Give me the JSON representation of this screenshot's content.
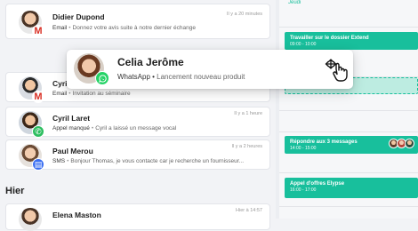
{
  "feed": {
    "items": [
      {
        "name": "Didier Dupond",
        "channel": "Email",
        "text": "Donnez votre avis suite à notre dernier échange",
        "time": "Il y a 20 minutes"
      },
      {
        "name": "Cyril Laret",
        "channel": "Email",
        "text": "Invitation au séminaire",
        "time": ""
      },
      {
        "name": "Cyril Laret",
        "channel": "Appel manqué",
        "text": "Cyril a laissé un message vocal",
        "time": "Il y a 1 heure"
      },
      {
        "name": "Paul Merou",
        "channel": "SMS",
        "text": "Bonjour Thomas, je vous contacte car je recherche un fournisseur...",
        "time": "Il y a 2 heures"
      },
      {
        "name": "Elena Maston",
        "channel": "",
        "text": "",
        "time": "Hier à 14:57"
      }
    ],
    "section_yesterday": "Hier"
  },
  "dragged": {
    "name": "Celia Jerôme",
    "channel": "WhatsApp",
    "text": "Lancement nouveau produit"
  },
  "calendar": {
    "top_label": "Jeudi",
    "events": [
      {
        "title": "Travailler sur le dossier Extend",
        "time": "09:00 - 10:00"
      },
      {
        "title": "Répondre aux 3 messages",
        "time": "14:00 - 15:00"
      },
      {
        "title": "Appel d'offres Elypse",
        "time": "16:00 - 17:00"
      }
    ]
  },
  "colors": {
    "accent": "#18bf9c",
    "whatsapp": "#25d366",
    "sms": "#3b6ff2",
    "call": "#2dbe60",
    "gmail": "#d93025"
  }
}
